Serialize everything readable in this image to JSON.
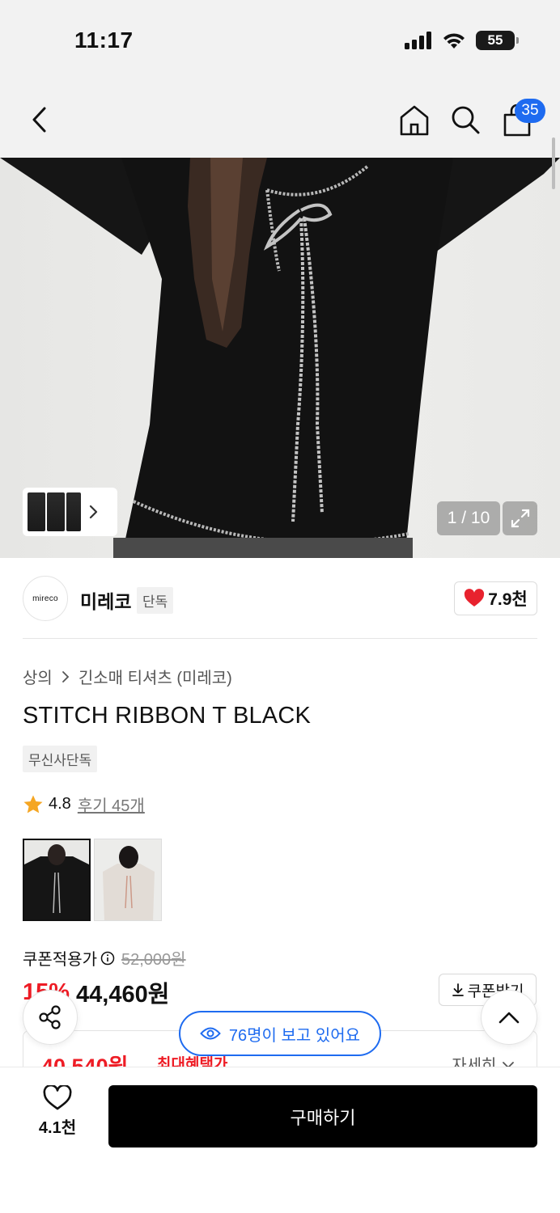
{
  "status_bar": {
    "time": "11:17",
    "battery": "55"
  },
  "nav": {
    "cart_count": "35"
  },
  "hero": {
    "image_counter": "1 / 10"
  },
  "brand": {
    "logo_text": "mireco",
    "name": "미레코",
    "tag": "단독",
    "likes": "7.9천"
  },
  "breadcrumb": {
    "category": "상의",
    "subcategory": "긴소매 티셔츠 (미레코)"
  },
  "product": {
    "title": "STITCH RIBBON T BLACK",
    "exclusive_tag": "무신사단독",
    "rating": "4.8",
    "review_label": "후기 45개"
  },
  "price": {
    "label": "쿠폰적용가",
    "original": "52,000원",
    "discount": "15%",
    "sale": "44,460원",
    "coupon_button": "쿠폰받기"
  },
  "benefit": {
    "price": "40,540원",
    "label": "최대혜택가",
    "detail": "자세히"
  },
  "viewers": {
    "text": "76명이 보고 있어요"
  },
  "bottom": {
    "wish_count": "4.1천",
    "buy_label": "구매하기"
  },
  "colors": {
    "accent": "#1e6bf0",
    "sale_red": "#ee1c25",
    "heart_red": "#e8222e"
  }
}
